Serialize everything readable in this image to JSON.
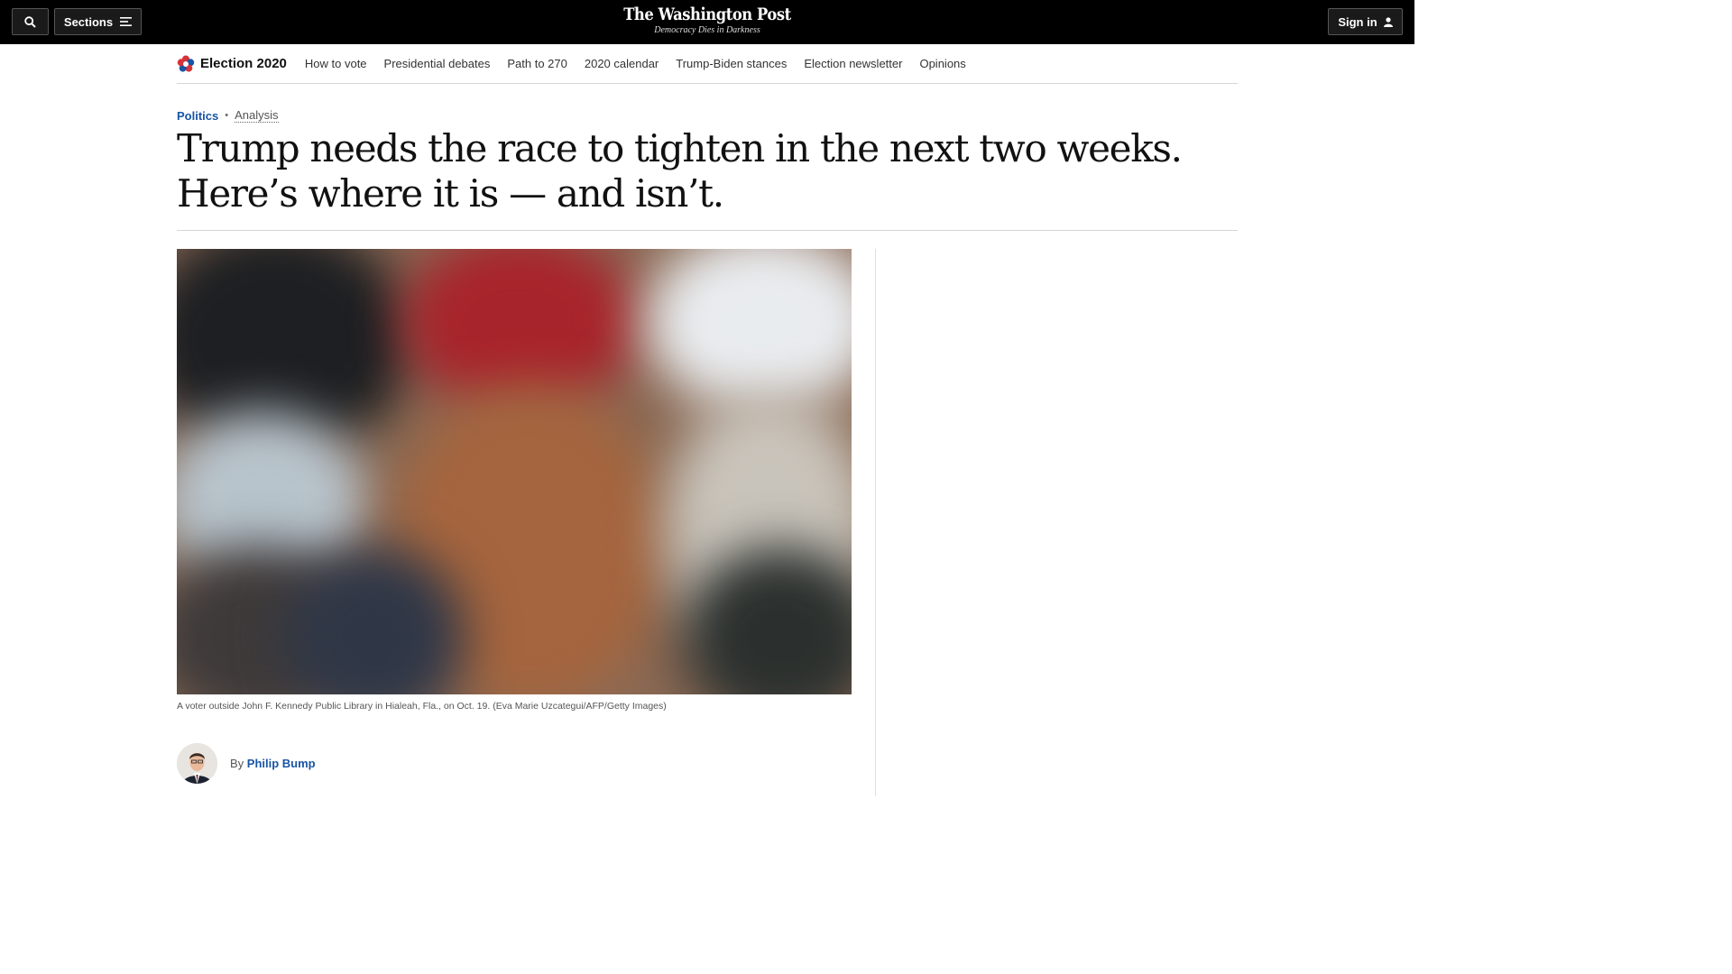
{
  "topbar": {
    "sections_label": "Sections",
    "signin_label": "Sign in",
    "logo": "The Washington Post",
    "tagline": "Democracy Dies in Darkness"
  },
  "subnav": {
    "brand": "Election 2020",
    "links": [
      "How to vote",
      "Presidential debates",
      "Path to 270",
      "2020 calendar",
      "Trump-Biden stances",
      "Election newsletter",
      "Opinions"
    ]
  },
  "article": {
    "section": "Politics",
    "label": "Analysis",
    "headline_line1": "Trump needs the race to tighten in the next two weeks.",
    "headline_line2": "Here’s where it is — and isn’t.",
    "caption": "A voter outside John F. Kennedy Public Library in Hialeah, Fla., on Oct. 19. (Eva Marie Uzcategui/AFP/Getty Images)",
    "byline_prefix": "By",
    "author": "Philip Bump"
  },
  "colors": {
    "accent_blue": "#1955a5",
    "topbar_bg": "#000000"
  },
  "icons": {
    "search": "search-icon",
    "sections": "menu-lines-icon",
    "signin": "user-icon",
    "election": "election-star-icon"
  }
}
